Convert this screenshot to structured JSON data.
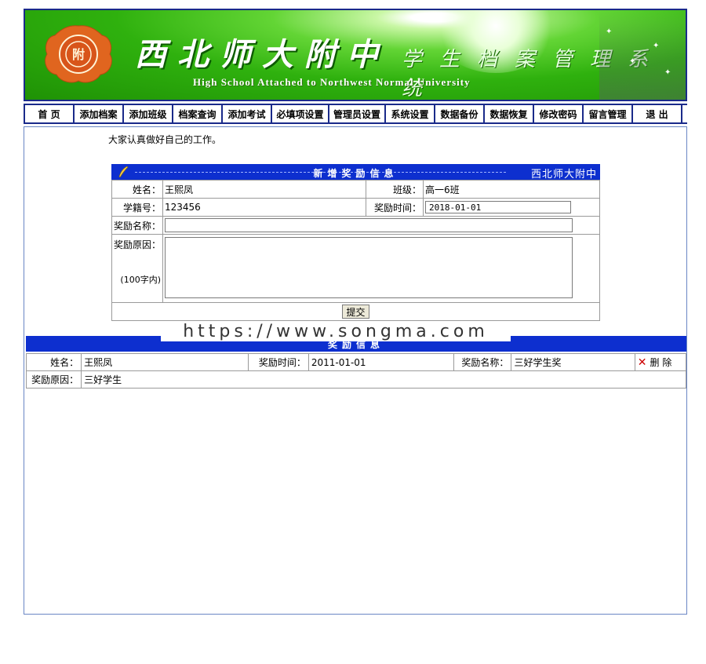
{
  "banner": {
    "school_cn": "西北师大附中",
    "system_cn": "学生档案管理系统",
    "school_en": "High School Attached to Northwest Normal University"
  },
  "nav": [
    "首 页",
    "添加档案",
    "添加班级",
    "档案查询",
    "添加考试",
    "必填项设置",
    "管理员设置",
    "系统设置",
    "数据备份",
    "数据恢复",
    "修改密码",
    "留言管理",
    "退 出"
  ],
  "notice": "大家认真做好自己的工作。",
  "form": {
    "title": "新增奖励信息",
    "header_right": "西北师大附中",
    "name_label": "姓名：",
    "name_value": "王熙凤",
    "class_label": "班级：",
    "class_value": "高一6班",
    "student_id_label": "学籍号：",
    "student_id_value": "123456",
    "award_time_label": "奖励时间：",
    "award_time_value": "2018-01-01",
    "award_name_label": "奖励名称：",
    "award_name_value": "",
    "reason_label": "奖励原因：",
    "reason_hint": "(100字内)",
    "reason_value": "",
    "submit_label": "提交"
  },
  "watermark": "https://www.songma.com",
  "list": {
    "title": "奖励信息",
    "rows": [
      {
        "name_label": "姓名：",
        "name": "王熙凤",
        "time_label": "奖励时间：",
        "time": "2011-01-01",
        "award_label": "奖励名称：",
        "award": "三好学生奖",
        "delete_label": "删 除",
        "reason_label": "奖励原因：",
        "reason": "三好学生"
      }
    ]
  },
  "colors": {
    "accent_blue": "#0d2fcf",
    "banner_green": "#2fb10e",
    "border_navy": "#1a2a8a"
  }
}
